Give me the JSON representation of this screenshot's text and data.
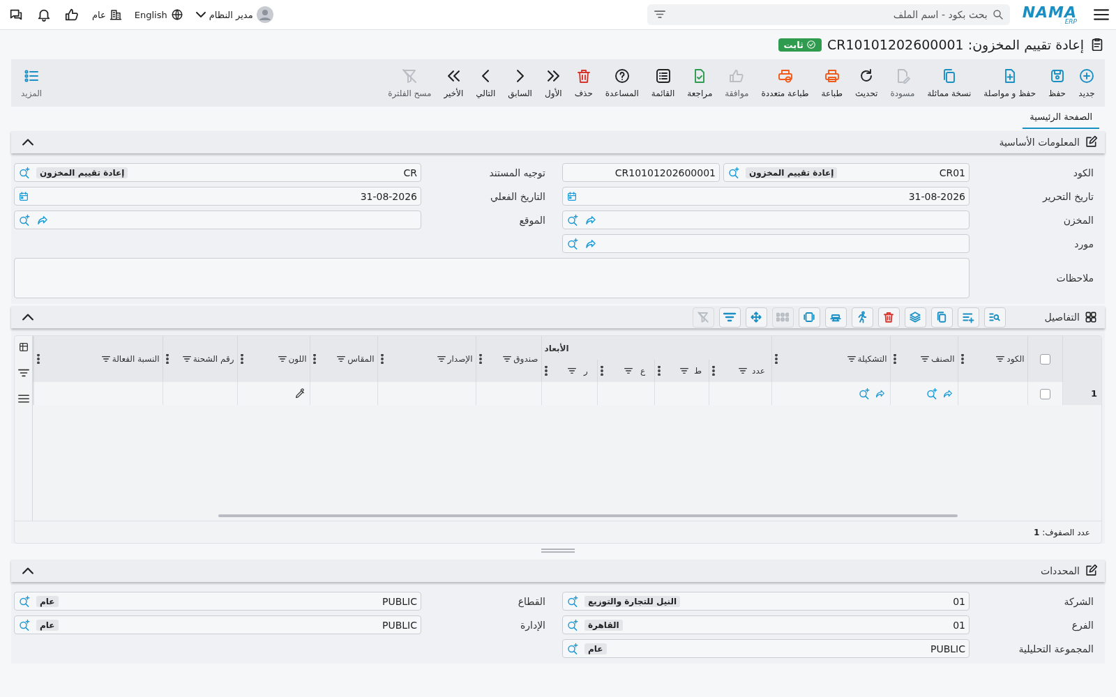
{
  "top_bar": {
    "logo": {
      "name": "NAMA",
      "sub": "ERP"
    },
    "search": {
      "placeholder": "بحث بكود - اسم الملف"
    },
    "organization": "عام",
    "language": "English",
    "user": "مدير النظام"
  },
  "title": {
    "text": "إعادة تقييم المخزون: CR10101202600001",
    "status": "ثابت"
  },
  "toolbar": [
    {
      "label": "جديد",
      "kind": "plus-circle",
      "color": "#1a8fc4",
      "disabled": false
    },
    {
      "label": "حفظ",
      "kind": "save",
      "color": "#1a8fc4",
      "disabled": false
    },
    {
      "label": "حفظ و مواصلة",
      "kind": "file-plus",
      "color": "#1a8fc4",
      "disabled": false
    },
    {
      "label": "نسخة مماثلة",
      "kind": "copy",
      "color": "#1a8fc4",
      "disabled": false
    },
    {
      "label": "مسودة",
      "kind": "file-edit",
      "color": "#b9bec5",
      "disabled": true
    },
    {
      "label": "تحديث",
      "kind": "refresh",
      "color": "#222222",
      "disabled": false
    },
    {
      "label": "طباعة",
      "kind": "printer",
      "color": "#f05a1a",
      "disabled": false
    },
    {
      "label": "طباعة متعددة",
      "kind": "printer-gear",
      "color": "#f05a1a",
      "disabled": false
    },
    {
      "label": "موافقة",
      "kind": "thumbs-up",
      "color": "#b9bec5",
      "disabled": true
    },
    {
      "label": "مراجعة",
      "kind": "file-check",
      "color": "#2e9b4e",
      "disabled": false
    },
    {
      "label": "القائمة",
      "kind": "list-box",
      "color": "#222222",
      "disabled": false
    },
    {
      "label": "المساعدة",
      "kind": "help-circle",
      "color": "#222222",
      "disabled": false
    },
    {
      "label": "حذف",
      "kind": "trash",
      "color": "#d9342b",
      "disabled": false
    },
    {
      "label": "الأول",
      "kind": "chevrons-right",
      "color": "#222222",
      "disabled": false
    },
    {
      "label": "السابق",
      "kind": "chevron-right",
      "color": "#222222",
      "disabled": false
    },
    {
      "label": "التالي",
      "kind": "chevron-left",
      "color": "#222222",
      "disabled": false
    },
    {
      "label": "الأخير",
      "kind": "chevrons-left",
      "color": "#222222",
      "disabled": false
    },
    {
      "label": "مسح الفلترة",
      "kind": "filter-off",
      "color": "#b9bec5",
      "disabled": true
    }
  ],
  "more_button": {
    "label": "المزيد"
  },
  "tabs": [
    {
      "label": "الصفحة الرئيسية",
      "selected": true
    }
  ],
  "basic_info": {
    "title": "المعلومات الأساسية",
    "expanded": true,
    "fields": [
      {
        "label": "الكود",
        "kind": "code_number",
        "value": "CR01",
        "tag": "إعادة تقييم المخزون",
        "number": "CR10101202600001"
      },
      {
        "label": "توجيه المستند",
        "kind": "lookup",
        "value": "CR",
        "tag": "إعادة تقييم المخزون"
      },
      {
        "label": "تاريخ التحرير",
        "kind": "date",
        "value": "31-08-2026"
      },
      {
        "label": "التاريخ الفعلي",
        "kind": "date",
        "value": "31-08-2026"
      },
      {
        "label": "المخزن",
        "kind": "lookup_goto"
      },
      {
        "label": "الموقع",
        "kind": "lookup_goto"
      },
      {
        "label": "مورد",
        "kind": "lookup_goto"
      },
      {
        "label": "ملاحظات",
        "kind": "notes"
      }
    ]
  },
  "details": {
    "title": "التفاصيل",
    "expanded": true,
    "tools": [
      {
        "kind": "list-search",
        "color": "#1a8fc4",
        "disabled": false
      },
      {
        "kind": "list-plus",
        "color": "#1a8fc4",
        "disabled": false
      },
      {
        "kind": "copy",
        "color": "#1a8fc4",
        "disabled": false
      },
      {
        "kind": "layers",
        "color": "#1a8fc4",
        "disabled": false
      },
      {
        "kind": "trash",
        "color": "#d9342b",
        "disabled": false
      },
      {
        "kind": "runner",
        "color": "#1a8fc4",
        "disabled": false
      },
      {
        "kind": "stack",
        "color": "#1a8fc4",
        "disabled": false
      },
      {
        "kind": "frame",
        "color": "#1a8fc4",
        "disabled": false
      },
      {
        "kind": "dots-grid",
        "color": "#b9bec5",
        "disabled": true
      },
      {
        "kind": "move",
        "color": "#1a8fc4",
        "disabled": false
      },
      {
        "kind": "filter-lines",
        "color": "#1a8fc4",
        "disabled": false
      },
      {
        "kind": "filter-off",
        "color": "#b9bec5",
        "disabled": true
      }
    ],
    "columns": [
      {
        "label": "الكود",
        "kind": "text"
      },
      {
        "label": "الصنف",
        "kind": "lookup_goto"
      },
      {
        "label": "التشكيلة",
        "kind": "lookup_goto"
      },
      {
        "label": "الأبعاد",
        "kind": "group",
        "children": [
          {
            "label": "عدد"
          },
          {
            "label": "ط"
          },
          {
            "label": "ع"
          },
          {
            "label": "ر"
          }
        ]
      },
      {
        "label": "صندوق",
        "kind": "text"
      },
      {
        "label": "الإصدار",
        "kind": "text"
      },
      {
        "label": "المقاس",
        "kind": "text"
      },
      {
        "label": "اللون",
        "kind": "color_picker"
      },
      {
        "label": "رقم الشحنة",
        "kind": "text"
      },
      {
        "label": "النسبة الفعالة",
        "kind": "text"
      }
    ],
    "all_checked": false,
    "rows": [
      {
        "number": "1",
        "checked": false
      }
    ],
    "row_count": "عدد الصفوف: **1**"
  },
  "determinants": {
    "title": "المحددات",
    "expanded": true,
    "fields": [
      {
        "label": "الشركة",
        "kind": "lookup",
        "value": "01",
        "tag": "النيل للتجارة والتوزيع"
      },
      {
        "label": "القطاع",
        "kind": "lookup",
        "value": "PUBLIC",
        "tag": "عام"
      },
      {
        "label": "الفرع",
        "kind": "lookup",
        "value": "01",
        "tag": "القاهرة"
      },
      {
        "label": "الإدارة",
        "kind": "lookup",
        "value": "PUBLIC",
        "tag": "عام"
      },
      {
        "label": "المجموعة التحليلية",
        "kind": "lookup",
        "value": "PUBLIC",
        "tag": "عام"
      }
    ]
  }
}
